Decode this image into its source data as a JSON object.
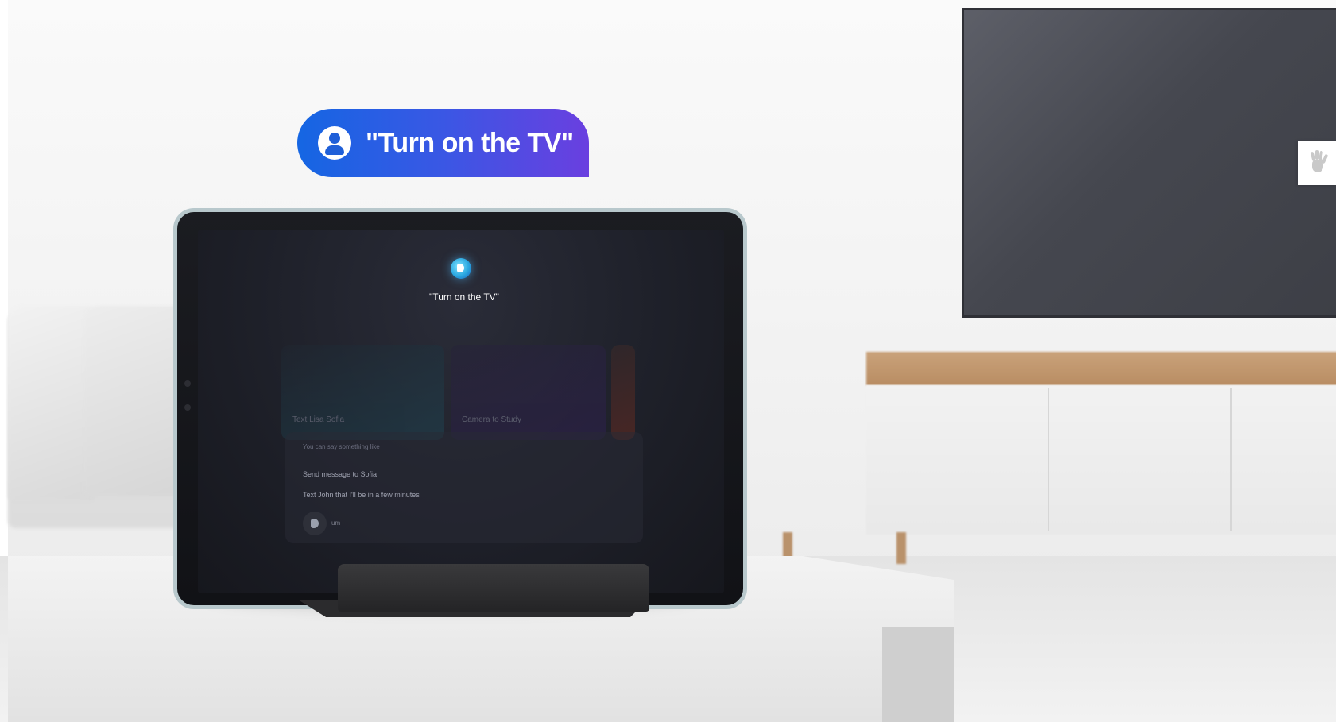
{
  "voice_command": {
    "text": "\"Turn on the TV\"",
    "icon": "user-icon",
    "gradient_colors": [
      "#1566e3",
      "#6a3fe0"
    ]
  },
  "tablet_screen": {
    "assistant_icon": "bixby-icon",
    "query_text": "\"Turn on the TV\"",
    "cards": [
      "Text Lisa Sofia",
      "Camera to Study"
    ],
    "suggestions_hint": "You can say something like",
    "suggestions": [
      "Send message to Sofia",
      "Text John that I'll be in a few minutes"
    ],
    "mic_label": "um",
    "nav_buttons": {
      "recents": "|||",
      "home": "O",
      "back": "<"
    }
  },
  "side_tab": {
    "icon": "hand-icon"
  }
}
